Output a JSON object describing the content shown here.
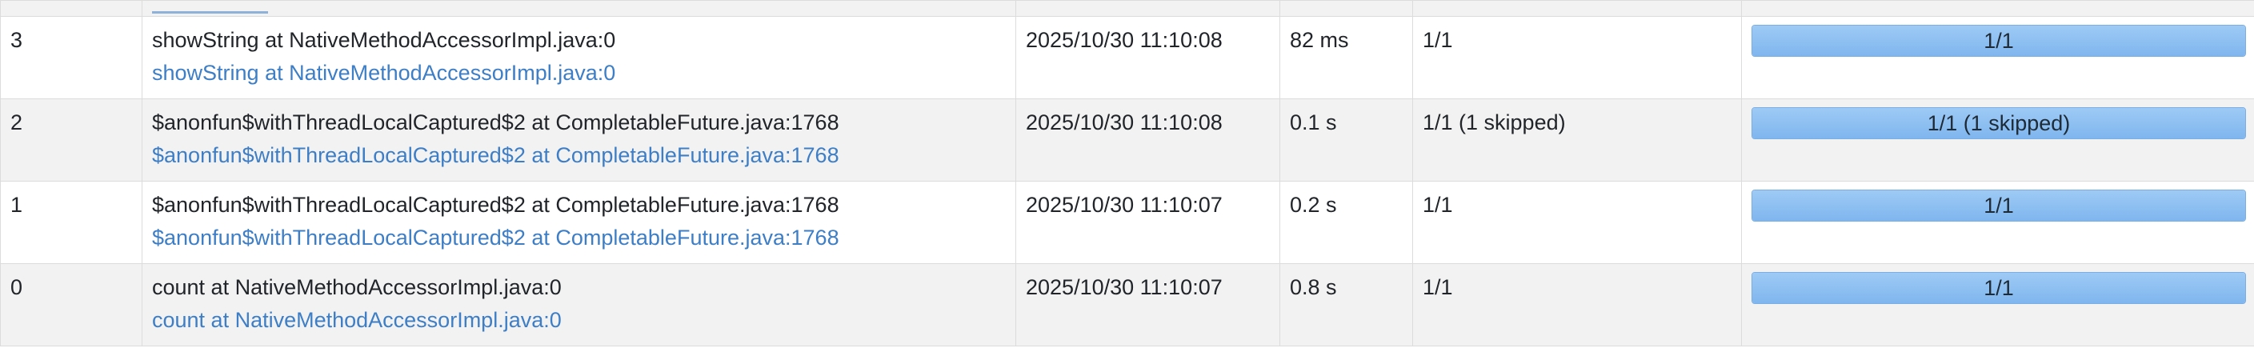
{
  "jobs": [
    {
      "id": "3",
      "description": "showString at NativeMethodAccessorImpl.java:0",
      "link": "showString at NativeMethodAccessorImpl.java:0",
      "submitted": "2025/10/30 11:10:08",
      "duration": "82 ms",
      "stages": "1/1",
      "tasks_label": "1/1",
      "tasks_progress": 1.0
    },
    {
      "id": "2",
      "description": "$anonfun$withThreadLocalCaptured$2 at CompletableFuture.java:1768",
      "link": "$anonfun$withThreadLocalCaptured$2 at CompletableFuture.java:1768",
      "submitted": "2025/10/30 11:10:08",
      "duration": "0.1 s",
      "stages": "1/1 (1 skipped)",
      "tasks_label": "1/1 (1 skipped)",
      "tasks_progress": 1.0
    },
    {
      "id": "1",
      "description": "$anonfun$withThreadLocalCaptured$2 at CompletableFuture.java:1768",
      "link": "$anonfun$withThreadLocalCaptured$2 at CompletableFuture.java:1768",
      "submitted": "2025/10/30 11:10:07",
      "duration": "0.2 s",
      "stages": "1/1",
      "tasks_label": "1/1",
      "tasks_progress": 1.0
    },
    {
      "id": "0",
      "description": "count at NativeMethodAccessorImpl.java:0",
      "link": "count at NativeMethodAccessorImpl.java:0",
      "submitted": "2025/10/30 11:10:07",
      "duration": "0.8 s",
      "stages": "1/1",
      "tasks_label": "1/1",
      "tasks_progress": 1.0
    }
  ],
  "colors": {
    "link": "#3d7ec6",
    "progress_fill": "#8cc0f2",
    "progress_border": "#79aee6",
    "row_alt": "#f2f2f2"
  }
}
